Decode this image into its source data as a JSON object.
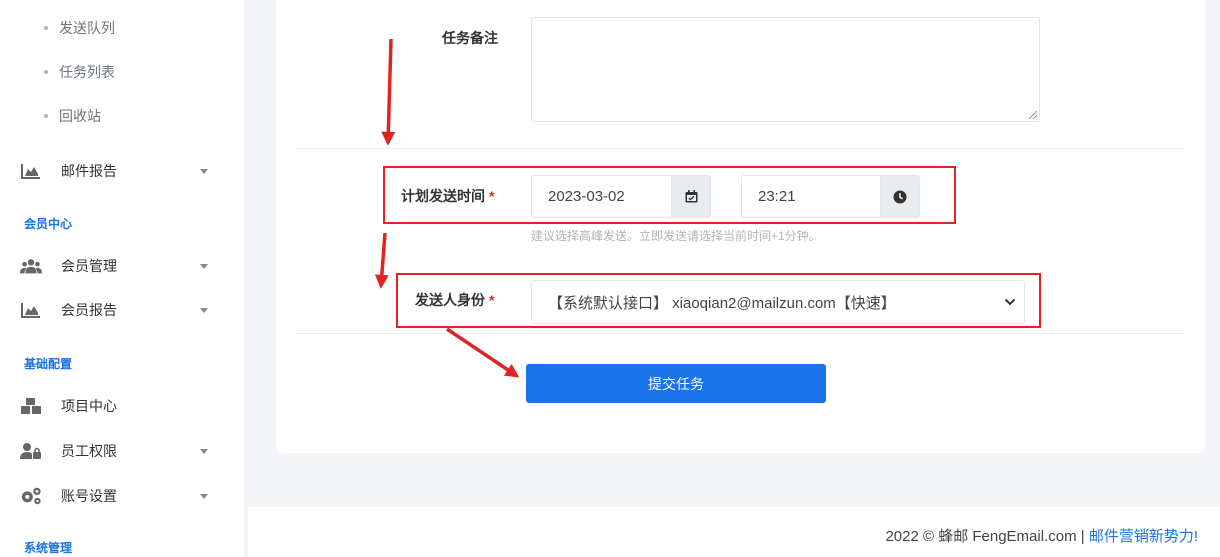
{
  "sidebar": {
    "sub_items": [
      "发送队列",
      "任务列表",
      "回收站"
    ],
    "mail_report": {
      "label": "邮件报告",
      "icon": "chart-area-icon"
    },
    "sections": {
      "member_center": "会员中心",
      "basic_config": "基础配置",
      "system_admin": "系统管理"
    },
    "member_items": [
      {
        "label": "会员管理",
        "icon": "users-icon"
      },
      {
        "label": "会员报告",
        "icon": "chart-area-icon"
      }
    ],
    "config_items": [
      {
        "label": "项目中心",
        "icon": "boxes-icon"
      },
      {
        "label": "员工权限",
        "icon": "user-lock-icon"
      },
      {
        "label": "账号设置",
        "icon": "gears-icon"
      }
    ]
  },
  "form": {
    "remark_label": "任务备注",
    "schedule_label": "计划发送时间",
    "date_value": "2023-03-02",
    "time_value": "23:21",
    "schedule_hint": "建议选择高峰发送。立即发送请选择当前时间+1分钟。",
    "sender_label": "发送人身份",
    "sender_value": "【系统默认接口】 xiaoqian2@mailzun.com【快速】",
    "required_mark": "*",
    "submit_label": "提交任务"
  },
  "footer": {
    "copyright": "2022 © 蜂邮 FengEmail.com",
    "separator": "|",
    "slogan": "邮件营销新势力!"
  },
  "colors": {
    "primary": "#1a73e8",
    "annotation_red": "#e02424"
  }
}
